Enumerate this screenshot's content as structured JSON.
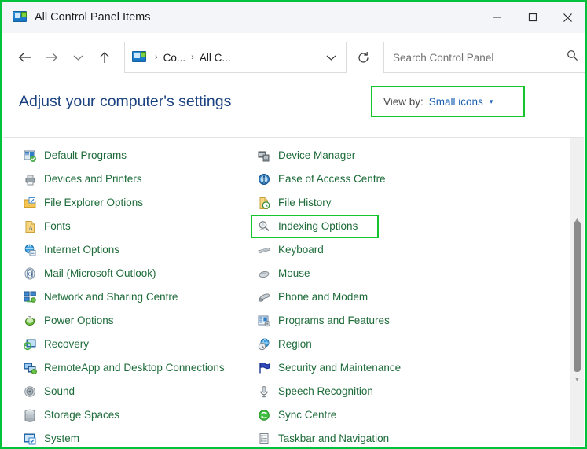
{
  "window": {
    "title": "All Control Panel Items",
    "title_icon": "control-panel-icon",
    "controls": {
      "minimize": "—",
      "maximize": "□",
      "close": "✕"
    }
  },
  "toolbar": {
    "back": "back-arrow-icon",
    "forward": "forward-arrow-icon",
    "recent": "chevron-down-icon",
    "up": "up-arrow-icon",
    "refresh": "refresh-icon",
    "breadcrumb": {
      "icon": "control-panel-icon",
      "segments": [
        "Co...",
        "All C..."
      ],
      "separator": "›",
      "dropdown": "chevron-down-icon"
    }
  },
  "search": {
    "placeholder": "Search Control Panel",
    "value": "",
    "icon": "search-icon"
  },
  "page": {
    "heading": "Adjust your computer's settings"
  },
  "view_by": {
    "label": "View by:",
    "value": "Small icons",
    "caret": "▾",
    "highlighted": true,
    "highlight_color": "#16c42e"
  },
  "colors": {
    "heading": "#1a4280",
    "item_text": "#1d6b39",
    "link": "#1a5fb4",
    "highlight": "#16c42e",
    "titlebar_bg": "#f3f5f9"
  },
  "items": {
    "left_column": [
      {
        "label": "Default Programs",
        "icon": "default-programs-icon"
      },
      {
        "label": "Devices and Printers",
        "icon": "devices-and-printers-icon"
      },
      {
        "label": "File Explorer Options",
        "icon": "file-explorer-options-icon"
      },
      {
        "label": "Fonts",
        "icon": "fonts-icon"
      },
      {
        "label": "Internet Options",
        "icon": "internet-options-icon"
      },
      {
        "label": "Mail (Microsoft Outlook)",
        "icon": "mail-icon"
      },
      {
        "label": "Network and Sharing Centre",
        "icon": "network-and-sharing-icon"
      },
      {
        "label": "Power Options",
        "icon": "power-options-icon"
      },
      {
        "label": "Recovery",
        "icon": "recovery-icon"
      },
      {
        "label": "RemoteApp and Desktop Connections",
        "icon": "remoteapp-icon"
      },
      {
        "label": "Sound",
        "icon": "sound-icon"
      },
      {
        "label": "Storage Spaces",
        "icon": "storage-spaces-icon"
      },
      {
        "label": "System",
        "icon": "system-icon"
      }
    ],
    "right_column": [
      {
        "label": "Device Manager",
        "icon": "device-manager-icon"
      },
      {
        "label": "Ease of Access Centre",
        "icon": "ease-of-access-icon"
      },
      {
        "label": "File History",
        "icon": "file-history-icon"
      },
      {
        "label": "Indexing Options",
        "icon": "indexing-options-icon",
        "highlighted": true
      },
      {
        "label": "Keyboard",
        "icon": "keyboard-icon"
      },
      {
        "label": "Mouse",
        "icon": "mouse-icon"
      },
      {
        "label": "Phone and Modem",
        "icon": "phone-and-modem-icon"
      },
      {
        "label": "Programs and Features",
        "icon": "programs-and-features-icon"
      },
      {
        "label": "Region",
        "icon": "region-icon"
      },
      {
        "label": "Security and Maintenance",
        "icon": "security-and-maintenance-icon"
      },
      {
        "label": "Speech Recognition",
        "icon": "speech-recognition-icon"
      },
      {
        "label": "Sync Centre",
        "icon": "sync-centre-icon"
      },
      {
        "label": "Taskbar and Navigation",
        "icon": "taskbar-and-navigation-icon"
      }
    ]
  },
  "scrollbar": {
    "up_arrow": "▲",
    "down_arrow": "▼",
    "orientation": "vertical"
  }
}
